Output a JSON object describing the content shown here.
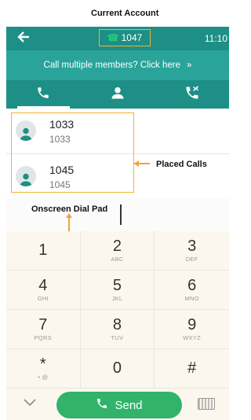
{
  "annotations": {
    "current_account": "Current Account",
    "placed_calls": "Placed Calls",
    "onscreen_dial_pad": "Onscreen Dial Pad"
  },
  "topbar": {
    "back_icon": "arrow-left-icon",
    "account_icon": "phone-handset-icon",
    "account_number": "1047",
    "time": "11:10"
  },
  "banner": {
    "text": "Call multiple members? Click here",
    "chevron": "»"
  },
  "tabs": [
    {
      "icon": "phone-icon",
      "active": true
    },
    {
      "icon": "contact-icon",
      "active": false
    },
    {
      "icon": "call-history-icon",
      "active": false
    }
  ],
  "placed_calls": [
    {
      "name": "1033",
      "number": "1033"
    },
    {
      "name": "1045",
      "number": "1045"
    }
  ],
  "dialpad": {
    "keys": [
      {
        "digit": "1",
        "letters": ""
      },
      {
        "digit": "2",
        "letters": "ABC"
      },
      {
        "digit": "3",
        "letters": "DEF"
      },
      {
        "digit": "4",
        "letters": "GHI"
      },
      {
        "digit": "5",
        "letters": "JKL"
      },
      {
        "digit": "6",
        "letters": "MNO"
      },
      {
        "digit": "7",
        "letters": "PQRS"
      },
      {
        "digit": "8",
        "letters": "TUV"
      },
      {
        "digit": "9",
        "letters": "WXYZ"
      },
      {
        "digit": "*",
        "letters": "• @"
      },
      {
        "digit": "0",
        "letters": ""
      },
      {
        "digit": "#",
        "letters": ""
      }
    ]
  },
  "bottom": {
    "collapse_icon": "chevron-down-icon",
    "send_label": "Send",
    "send_icon": "phone-handset-icon",
    "keyboard_icon": "keyboard-icon"
  },
  "colors": {
    "header": "#1e8f86",
    "banner": "#2aa49a",
    "send": "#31b36a",
    "annotation": "#f2b233"
  }
}
